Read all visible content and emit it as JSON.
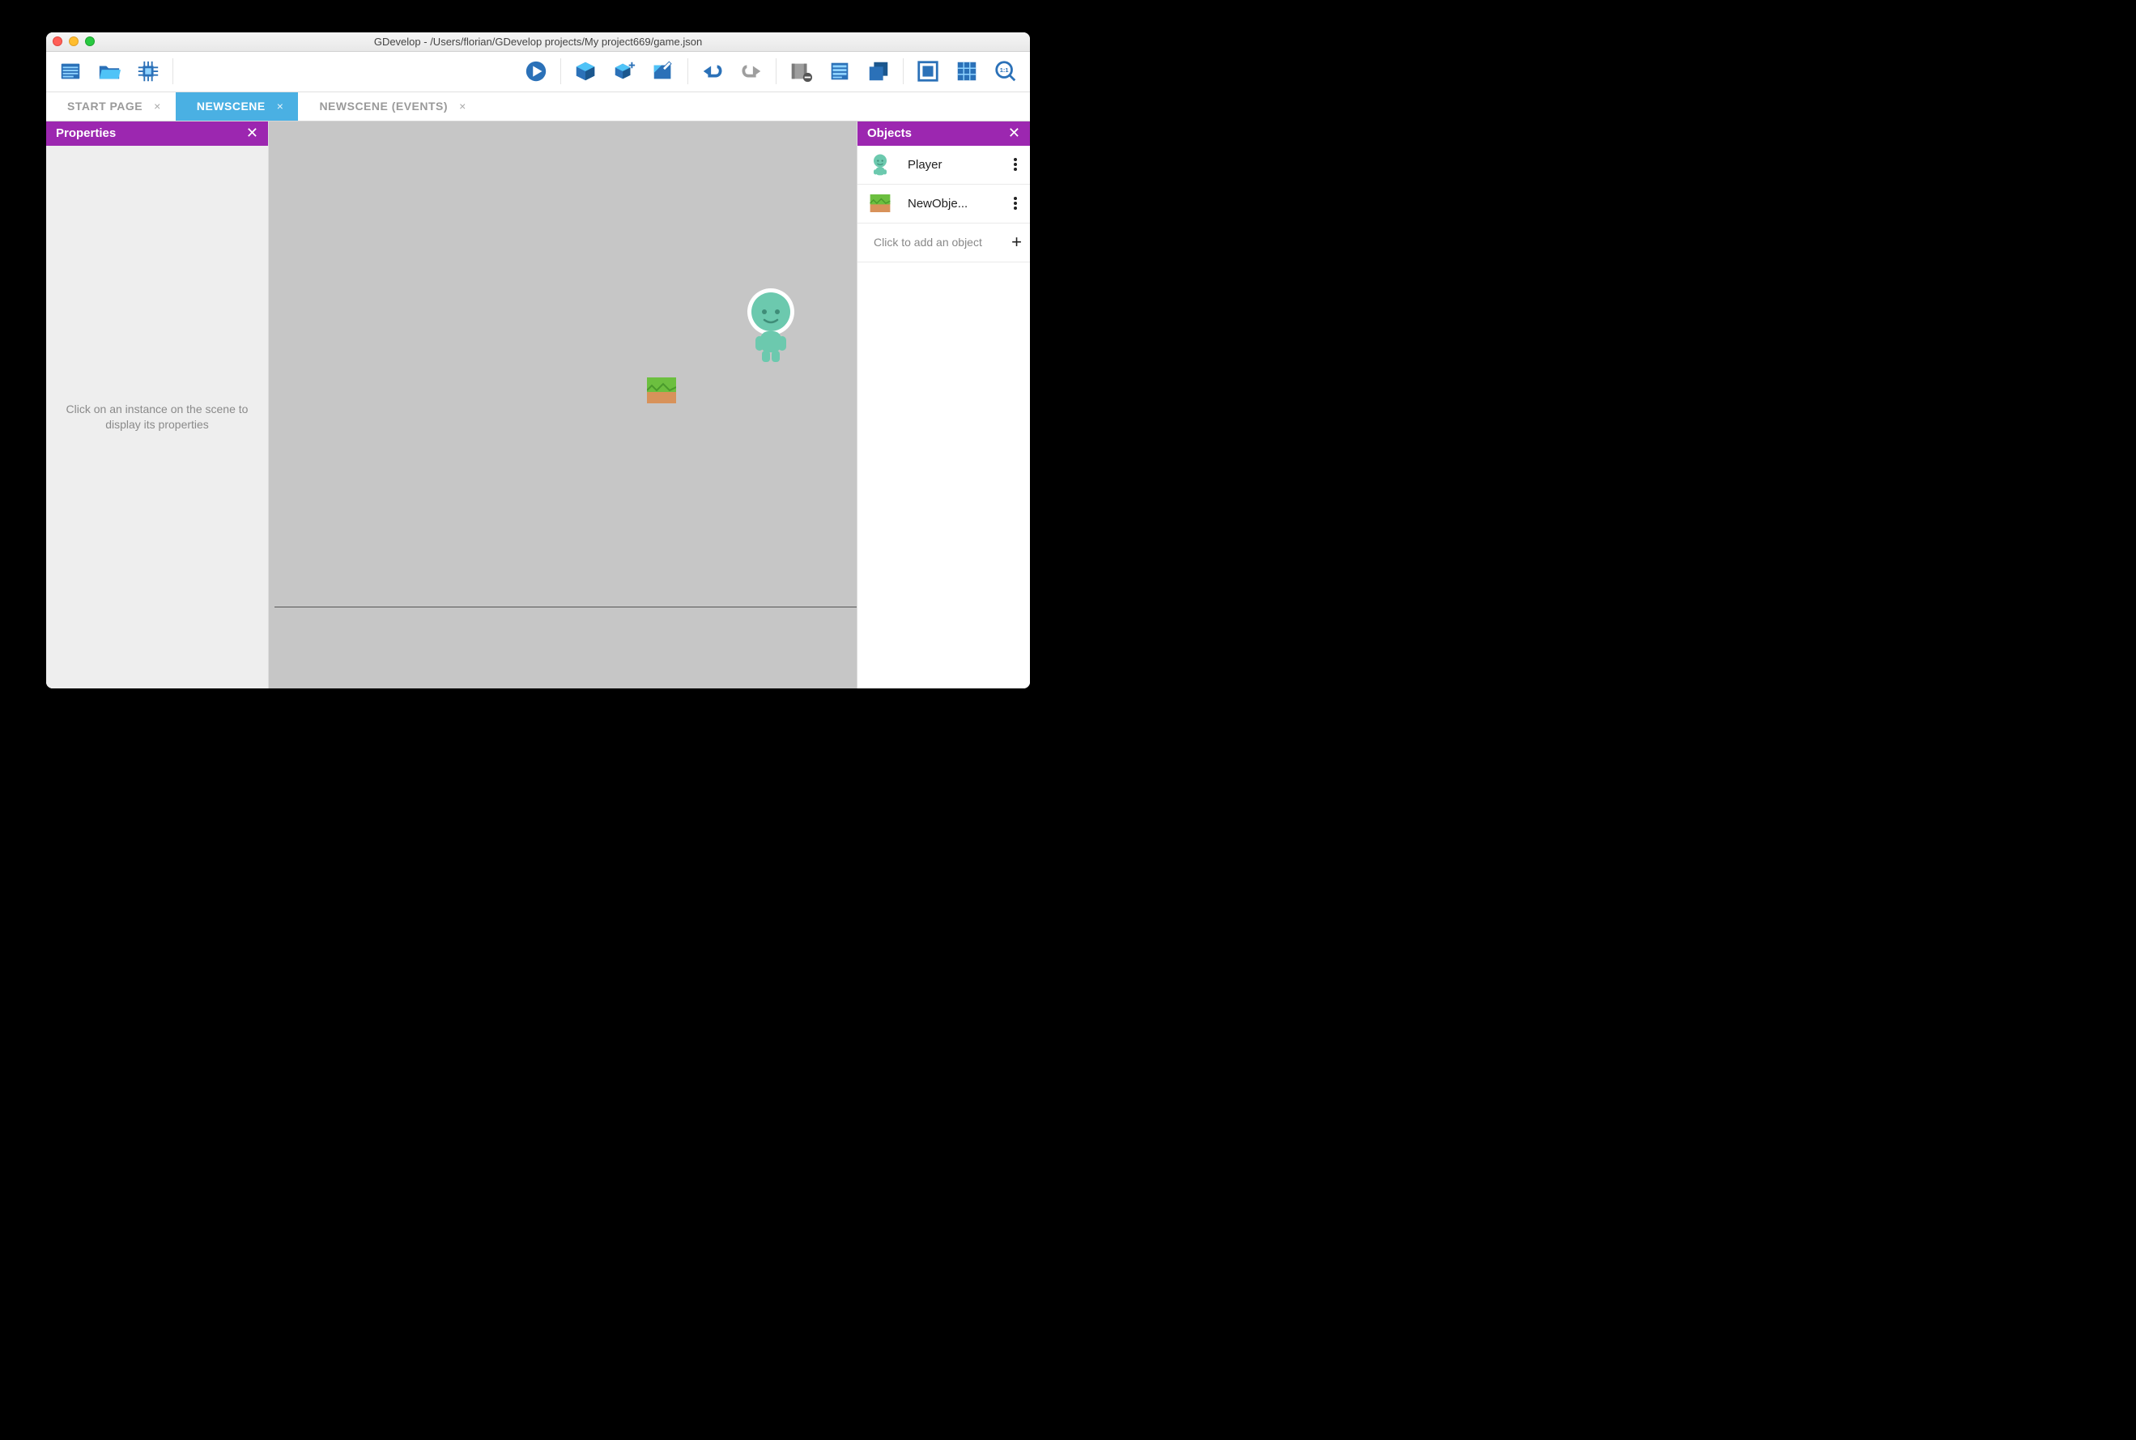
{
  "window": {
    "title": "GDevelop - /Users/florian/GDevelop projects/My project669/game.json"
  },
  "tabs": [
    {
      "label": "START PAGE",
      "active": false
    },
    {
      "label": "NEWSCENE",
      "active": true
    },
    {
      "label": "NEWSCENE (EVENTS)",
      "active": false
    }
  ],
  "panels": {
    "properties": {
      "title": "Properties",
      "placeholder": "Click on an instance on the scene to display its properties"
    },
    "objects": {
      "title": "Objects",
      "items": [
        {
          "name": "Player"
        },
        {
          "name": "NewObje..."
        }
      ],
      "add_label": "Click to add an object"
    }
  },
  "colors": {
    "accent_blue": "#2b71b8",
    "tab_active": "#4ab0e3",
    "panel_header": "#9c27b0"
  }
}
